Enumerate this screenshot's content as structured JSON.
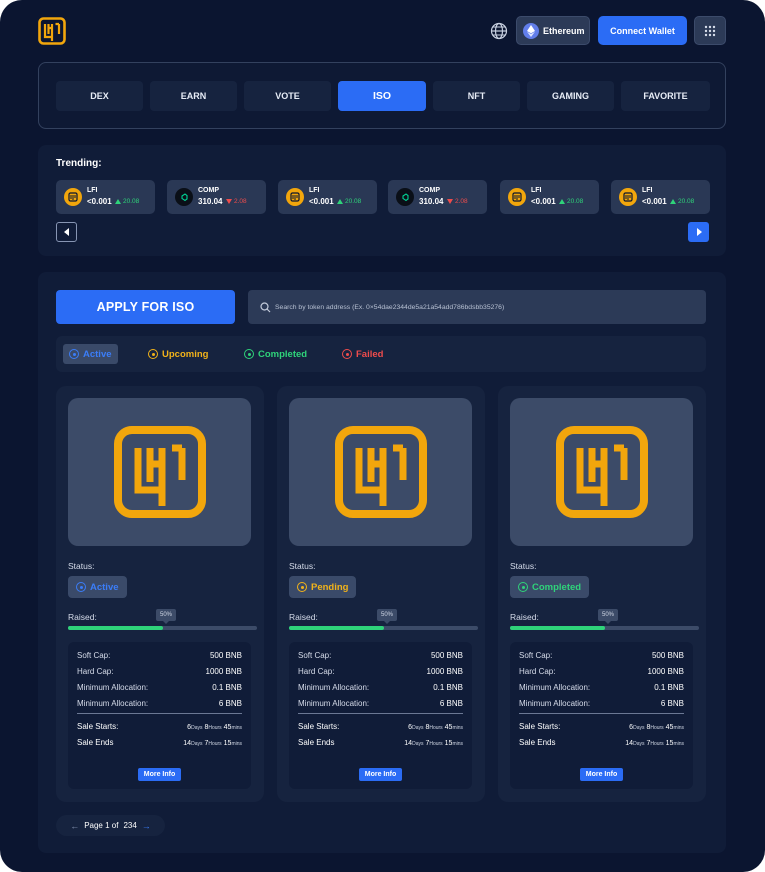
{
  "header": {
    "network_label": "Ethereum",
    "connect_label": "Connect Wallet",
    "icons": [
      "lfi-logo",
      "globe-icon",
      "ethereum-icon",
      "grid-menu-icon"
    ]
  },
  "tabs": [
    {
      "label": "DEX",
      "active": false
    },
    {
      "label": "EARN",
      "active": false
    },
    {
      "label": "VOTE",
      "active": false
    },
    {
      "label": "ISO",
      "active": true
    },
    {
      "label": "NFT",
      "active": false
    },
    {
      "label": "GAMING",
      "active": false
    },
    {
      "label": "FAVORITE",
      "active": false
    }
  ],
  "trending": {
    "title": "Trending:",
    "items": [
      {
        "symbol": "LFI",
        "price": "<0.001",
        "change": "20.08",
        "direction": "up"
      },
      {
        "symbol": "COMP",
        "price": "310.04",
        "change": "2.08",
        "direction": "down"
      },
      {
        "symbol": "LFI",
        "price": "<0.001",
        "change": "20.08",
        "direction": "up"
      },
      {
        "symbol": "COMP",
        "price": "310.04",
        "change": "2.08",
        "direction": "down"
      },
      {
        "symbol": "LFI",
        "price": "<0.001",
        "change": "20.08",
        "direction": "up"
      },
      {
        "symbol": "LFI",
        "price": "<0.001",
        "change": "20.08",
        "direction": "up"
      }
    ]
  },
  "iso": {
    "apply_label": "APPLY FOR ISO",
    "search_placeholder": "Search by token address (Ex. 0×54dae2344de5a21a54add786bdsbb35276)",
    "filters": [
      {
        "label": "Active",
        "color": "#3b7df8"
      },
      {
        "label": "Upcoming",
        "color": "#f2b31a"
      },
      {
        "label": "Completed",
        "color": "#2fd37a"
      },
      {
        "label": "Failed",
        "color": "#ef4c4c"
      }
    ],
    "cards": [
      {
        "status_label": "Status:",
        "status": "Active",
        "status_color": "#3b7df8",
        "raised_label": "Raised:",
        "progress": "50%",
        "progress_value": 0.5,
        "soft_cap_label": "Soft Cap:",
        "soft_cap": "500 BNB",
        "hard_cap_label": "Hard Cap:",
        "hard_cap": "1000 BNB",
        "min_alloc_label": "Minimum Allocation:",
        "min_alloc": "0.1 BNB",
        "max_alloc_label": "Minimum Allocation:",
        "max_alloc": "6 BNB",
        "sale_starts_label": "Sale Starts:",
        "sale_starts": {
          "d": "6",
          "h": "8",
          "m": "45"
        },
        "sale_ends_label": "Sale Ends",
        "sale_ends": {
          "d": "14",
          "h": "7",
          "m": "15"
        },
        "more_label": "More Info"
      },
      {
        "status_label": "Status:",
        "status": "Pending",
        "status_color": "#f2b31a",
        "raised_label": "Raised:",
        "progress": "50%",
        "progress_value": 0.5,
        "soft_cap_label": "Soft Cap:",
        "soft_cap": "500 BNB",
        "hard_cap_label": "Hard Cap:",
        "hard_cap": "1000 BNB",
        "min_alloc_label": "Minimum Allocation:",
        "min_alloc": "0.1 BNB",
        "max_alloc_label": "Minimum Allocation:",
        "max_alloc": "6 BNB",
        "sale_starts_label": "Sale Starts:",
        "sale_starts": {
          "d": "6",
          "h": "8",
          "m": "45"
        },
        "sale_ends_label": "Sale Ends",
        "sale_ends": {
          "d": "14",
          "h": "7",
          "m": "15"
        },
        "more_label": "More Info"
      },
      {
        "status_label": "Status:",
        "status": "Completed",
        "status_color": "#2fd37a",
        "raised_label": "Raised:",
        "progress": "50%",
        "progress_value": 0.5,
        "soft_cap_label": "Soft Cap:",
        "soft_cap": "500 BNB",
        "hard_cap_label": "Hard Cap:",
        "hard_cap": "1000 BNB",
        "min_alloc_label": "Minimum Allocation:",
        "min_alloc": "0.1 BNB",
        "max_alloc_label": "Minimum Allocation:",
        "max_alloc": "6 BNB",
        "sale_starts_label": "Sale Starts:",
        "sale_starts": {
          "d": "6",
          "h": "8",
          "m": "45"
        },
        "sale_ends_label": "Sale Ends",
        "sale_ends": {
          "d": "14",
          "h": "7",
          "m": "15"
        },
        "more_label": "More Info"
      }
    ],
    "time_units": {
      "days": "Days",
      "hours": "Hours",
      "mins": "mins"
    }
  },
  "pager": {
    "prefix": "Page 1 of",
    "total": "234"
  },
  "colors": {
    "accent": "#2b6cf5",
    "brand_orange": "#f2a60c",
    "background": "#0b1530"
  }
}
